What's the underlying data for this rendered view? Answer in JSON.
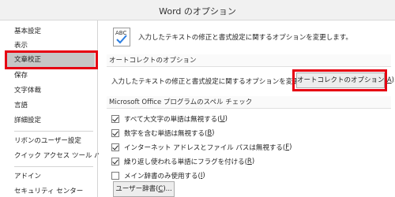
{
  "window": {
    "title": "Word のオプション"
  },
  "sidebar": {
    "items": [
      {
        "label": "基本設定"
      },
      {
        "label": "表示"
      },
      {
        "label": "文章校正"
      },
      {
        "label": "保存"
      },
      {
        "label": "文字体裁"
      },
      {
        "label": "言語"
      },
      {
        "label": "詳細設定"
      },
      {
        "label": "リボンのユーザー設定"
      },
      {
        "label": "クイック アクセス ツール バー"
      },
      {
        "label": "アドイン"
      },
      {
        "label": "セキュリティ センター"
      }
    ],
    "selected": "文章校正"
  },
  "main": {
    "intro_icon_text": "ABC",
    "intro": "入力したテキストの修正と書式設定に関するオプションを変更します。",
    "autocorrect": {
      "header": "オートコレクトのオプション",
      "description": "入力したテキストの修正と書式設定に関するオプションを変更します。",
      "button_label": "オートコレクトのオプション(",
      "button_key": "A",
      "button_suffix": ")..."
    },
    "spelling": {
      "header": "Microsoft Office プログラムのスペル チェック",
      "options": [
        {
          "label": "すべて大文字の単語は無視する(",
          "key": "U",
          "suffix": ")",
          "checked": true
        },
        {
          "label": "数字を含む単語は無視する(",
          "key": "B",
          "suffix": ")",
          "checked": true
        },
        {
          "label": "インターネット アドレスとファイル パスは無視する(",
          "key": "F",
          "suffix": ")",
          "checked": true
        },
        {
          "label": "繰り返し使われる単語にフラグを付ける(",
          "key": "R",
          "suffix": ")",
          "checked": true
        },
        {
          "label": "メイン辞書のみ使用する(",
          "key": "I",
          "suffix": ")",
          "checked": false
        }
      ],
      "dictionary_button": {
        "label": "ユーザー辞書(",
        "key": "C",
        "suffix": ")..."
      }
    }
  },
  "colors": {
    "highlight": "#e60012",
    "selected_bg": "#c6c6c6"
  }
}
